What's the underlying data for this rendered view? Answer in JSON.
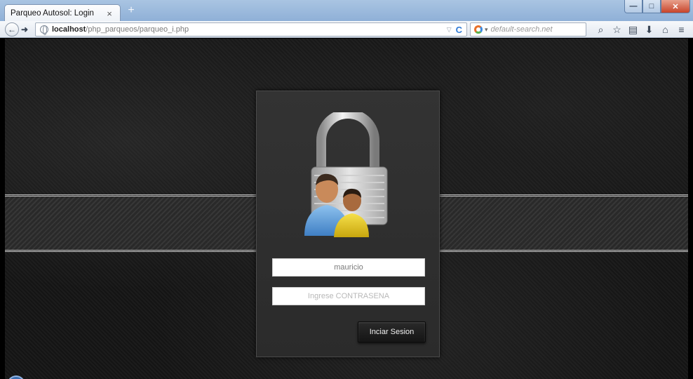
{
  "browser": {
    "tab_title": "Parqueo Autosol: Login",
    "tab_close": "×",
    "new_tab": "+",
    "url_host": "localhost",
    "url_path": "/php_parqueos/parqueo_i.php",
    "search_placeholder": "default-search.net",
    "icons": [
      "back-arrow",
      "forward-arrow",
      "reload",
      "search",
      "bookmark-star",
      "bookmarks-list",
      "downloads",
      "home",
      "menu"
    ]
  },
  "login": {
    "username_value": "mauricio",
    "password_placeholder": "Ingrese CONTRASENA",
    "submit_label": "Inciar Sesion"
  },
  "colors": {
    "panel_bg": "#2f2f2f",
    "button_bg": "#1c1c1c",
    "page_bg": "#141414",
    "band_border": "#cfcfcf"
  }
}
